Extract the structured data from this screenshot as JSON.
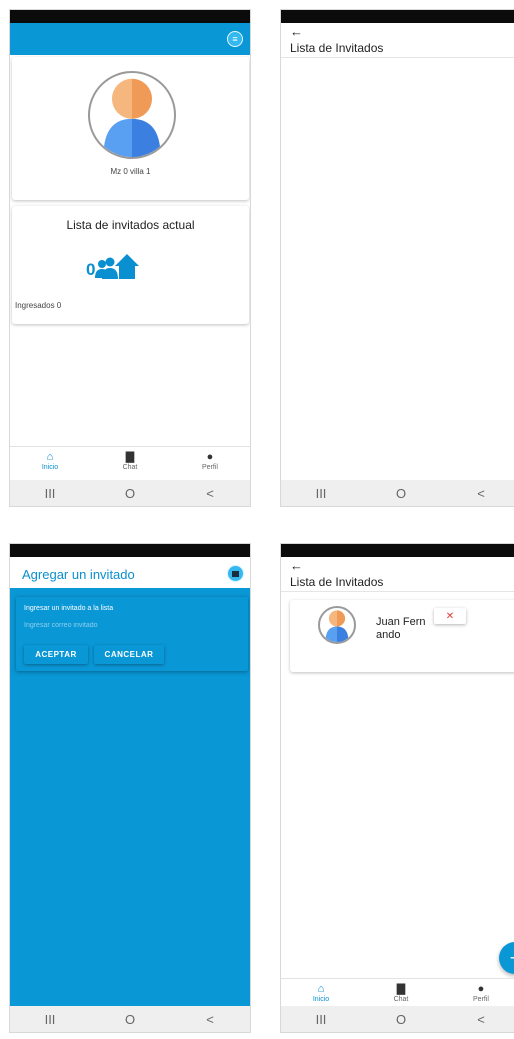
{
  "screen1": {
    "menu_icon": "menu-icon",
    "profile_address": "Mz 0 villa 1",
    "guests_title": "Lista de invitados actual",
    "guest_count": "0",
    "entered_label": "Ingresados 0",
    "tabs": [
      {
        "label": "Inicio",
        "icon": "home-icon",
        "active": true
      },
      {
        "label": "Chat",
        "icon": "chat-icon",
        "active": false
      },
      {
        "label": "Perfil",
        "icon": "person-icon",
        "active": false
      }
    ]
  },
  "screen2": {
    "title": "Lista de Invitados"
  },
  "screen3": {
    "title": "Agregar un invitado",
    "form_label": "Ingresar un invitado a la lista",
    "email_placeholder": "Ingresar correo invitado",
    "accept_label": "ACEPTAR",
    "cancel_label": "CANCELAR"
  },
  "screen4": {
    "title": "Lista de Invitados",
    "guest_name": "Juan Fernando",
    "delete_label": "✕",
    "fab_label": "+",
    "tabs": [
      {
        "label": "Inicio",
        "icon": "home-icon",
        "active": true
      },
      {
        "label": "Chat",
        "icon": "chat-icon",
        "active": false
      },
      {
        "label": "Perfil",
        "icon": "person-icon",
        "active": false
      }
    ]
  },
  "system_nav": [
    "III",
    "O",
    "<"
  ],
  "colors": {
    "primary": "#0a97d6",
    "danger": "#e53935"
  }
}
